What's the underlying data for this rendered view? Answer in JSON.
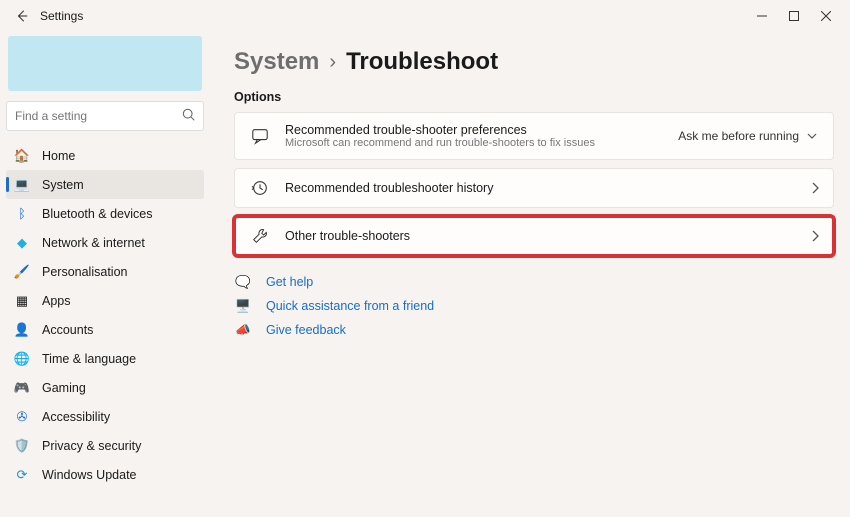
{
  "titlebar": {
    "title": "Settings"
  },
  "search": {
    "placeholder": "Find a setting"
  },
  "nav": {
    "items": [
      {
        "label": "Home"
      },
      {
        "label": "System"
      },
      {
        "label": "Bluetooth & devices"
      },
      {
        "label": "Network & internet"
      },
      {
        "label": "Personalisation"
      },
      {
        "label": "Apps"
      },
      {
        "label": "Accounts"
      },
      {
        "label": "Time & language"
      },
      {
        "label": "Gaming"
      },
      {
        "label": "Accessibility"
      },
      {
        "label": "Privacy & security"
      },
      {
        "label": "Windows Update"
      }
    ]
  },
  "breadcrumb": {
    "parent": "System",
    "sep": "›",
    "current": "Troubleshoot"
  },
  "section": {
    "options": "Options"
  },
  "card_prefs": {
    "title": "Recommended trouble-shooter preferences",
    "desc": "Microsoft can recommend and run trouble-shooters to fix issues",
    "dropdown": "Ask me before running"
  },
  "card_history": {
    "title": "Recommended troubleshooter history"
  },
  "card_other": {
    "title": "Other trouble-shooters"
  },
  "links": {
    "help": "Get help",
    "quick": "Quick assistance from a friend",
    "feedback": "Give feedback"
  }
}
